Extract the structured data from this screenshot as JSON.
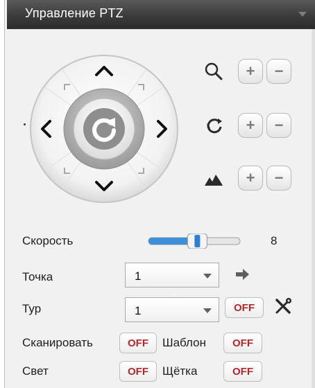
{
  "panel": {
    "title": "Управление PTZ"
  },
  "joystick": {
    "up_icon": "chevron-up-icon",
    "down_icon": "chevron-down-icon",
    "left_icon": "chevron-left-icon",
    "right_icon": "chevron-right-icon",
    "center_icon": "refresh-icon"
  },
  "controls": [
    {
      "icon": "zoom-icon",
      "plus": "+",
      "minus": "−"
    },
    {
      "icon": "focus-icon",
      "plus": "+",
      "minus": "−"
    },
    {
      "icon": "iris-icon",
      "plus": "+",
      "minus": "−"
    }
  ],
  "speed": {
    "label": "Скорость",
    "value": "8",
    "level": 8,
    "max": 15
  },
  "preset": {
    "label": "Точка",
    "value": "1",
    "go_icon": "arrow-right-icon"
  },
  "tour": {
    "label": "Тур",
    "value": "1",
    "toggle": "OFF",
    "settings_icon": "tools-icon"
  },
  "scan": {
    "label": "Сканировать",
    "toggle": "OFF"
  },
  "pattern": {
    "label": "Шаблон",
    "toggle": "OFF"
  },
  "light": {
    "label": "Свет",
    "toggle": "OFF"
  },
  "brush": {
    "label": "Щётка",
    "toggle": "OFF"
  },
  "colors": {
    "title_bar": "#3b3b3b",
    "off_text": "#b0272b",
    "slider_fill": "#3f8fd6"
  }
}
